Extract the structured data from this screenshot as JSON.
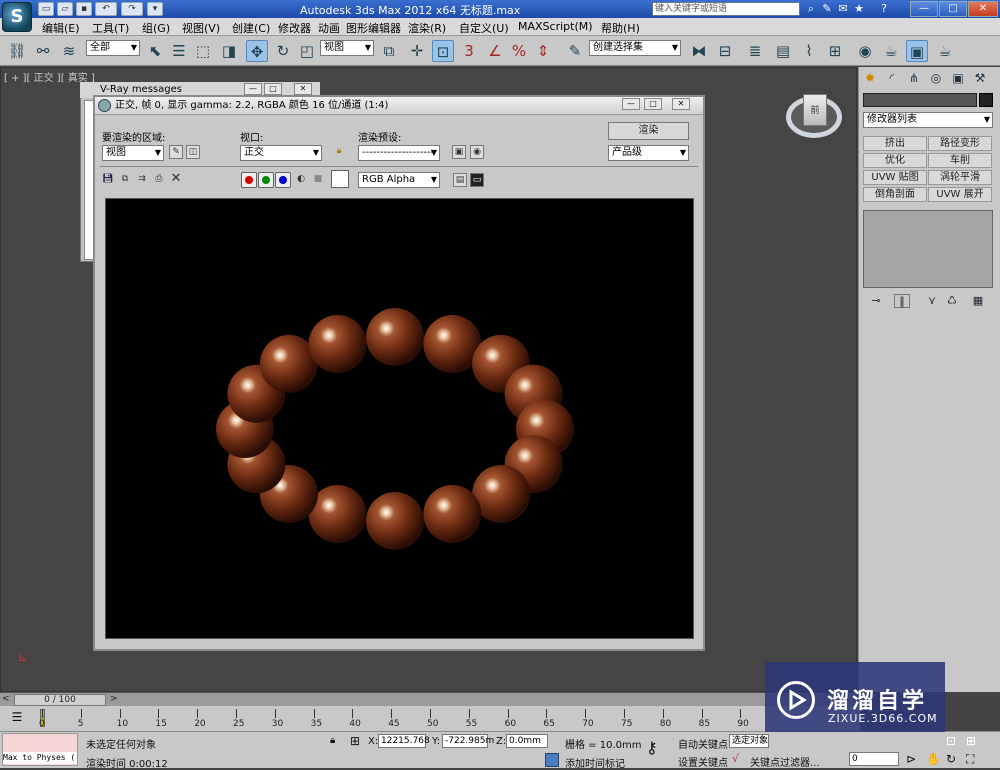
{
  "titlebar": {
    "app_logo": "S",
    "title": "Autodesk 3ds Max  2012 x64        无标题.max",
    "search_placeholder": "键入关键字或短语"
  },
  "menu": {
    "items": [
      "编辑(E)",
      "工具(T)",
      "组(G)",
      "视图(V)",
      "创建(C)",
      "修改器",
      "动画",
      "图形编辑器",
      "渲染(R)",
      "自定义(U)",
      "MAXScript(M)",
      "帮助(H)"
    ]
  },
  "toolbar": {
    "selection_filter": "全部",
    "ref_coord": "视图",
    "named_selection": "创建选择集",
    "snap_label": "3"
  },
  "viewport": {
    "label": "[ + ][ 正交 ][ 真实 ]",
    "viewcube_label": "前"
  },
  "command_panel": {
    "modifier_list": "修改器列表",
    "buttons": [
      "挤出",
      "路径变形",
      "优化",
      "车削",
      "UVW 贴图",
      "涡轮平滑",
      "倒角剖面",
      "UVW 展开"
    ]
  },
  "vray_messages": {
    "title": "V-Ray messages"
  },
  "vfb": {
    "title": "正交, 帧 0, 显示 gamma: 2.2, RGBA 颜色 16 位/通道 (1:4)",
    "region_label": "要渲染的区域:",
    "region_value": "视图",
    "viewport_label": "视口:",
    "viewport_value": "正交",
    "preset_label": "渲染预设:",
    "preset_value": "--------------------",
    "render_button": "渲染",
    "quality_value": "产品级",
    "channel_value": "RGB Alpha"
  },
  "timeline": {
    "slider": "0 / 100",
    "ticks": [
      "0",
      "5",
      "10",
      "15",
      "20",
      "25",
      "30",
      "35",
      "40",
      "45",
      "50",
      "55",
      "60",
      "65",
      "70",
      "75",
      "80",
      "85",
      "90"
    ]
  },
  "status": {
    "maxscript": "Max to Physes (",
    "selection_msg": "未选定任何对象",
    "render_time": "渲染时间  0:00:12",
    "x_label": "X:",
    "x_value": "12215.768",
    "y_label": "Y:",
    "y_value": "-722.985m",
    "z_label": "Z:",
    "z_value": "0.0mm",
    "grid": "栅格 = 10.0mm",
    "add_time_tag": "添加时间标记",
    "auto_key": "自动关键点",
    "set_key": "设置关键点",
    "selected": "选定对象",
    "key_filters": "关键点过滤器...",
    "frame": "0"
  },
  "watermark": {
    "title": "溜溜自学",
    "subtitle": "ZIXUE.3D66.COM"
  }
}
